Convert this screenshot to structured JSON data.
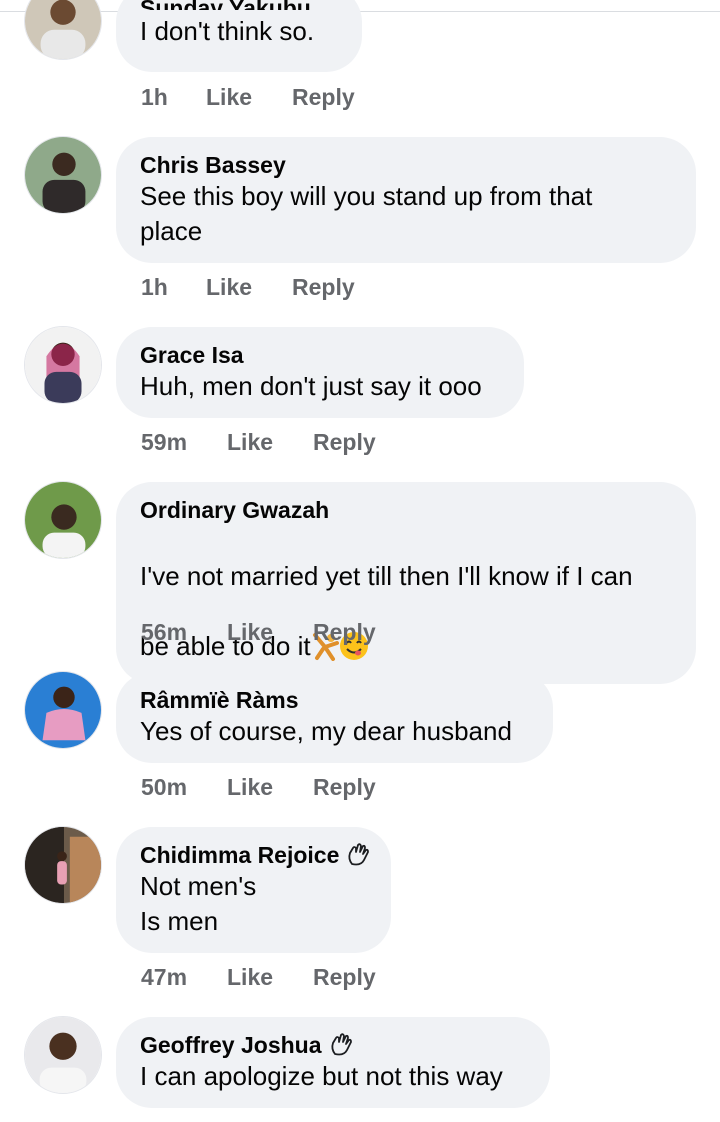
{
  "comments": [
    {
      "name": "Sunday Yakubu",
      "text": "I don't think so.",
      "time": "1h",
      "like": "Like",
      "reply": "Reply"
    },
    {
      "name": "Chris Bassey",
      "text": "See this boy will you stand up from that\nplace",
      "time": "1h",
      "like": "Like",
      "reply": "Reply"
    },
    {
      "name": "Grace Isa",
      "text": "Huh, men don't just say it ooo",
      "time": "59m",
      "like": "Like",
      "reply": "Reply"
    },
    {
      "name": "Ordinary Gwazah",
      "text_line1": "I've not married yet till then I'll know if I can",
      "text_line2": "be able to do it",
      "time": "56m",
      "like": "Like",
      "reply": "Reply"
    },
    {
      "name": "Râmmïè Ràms",
      "text": "Yes of course, my dear husband",
      "time": "50m",
      "like": "Like",
      "reply": "Reply"
    },
    {
      "name": "Chidimma Rejoice",
      "text": "Not men's\nIs men",
      "time": "47m",
      "like": "Like",
      "reply": "Reply"
    },
    {
      "name": "Geoffrey Joshua",
      "text": "I can apologize but not this way"
    }
  ],
  "icons": {
    "badge": "waving-hand-badge-icon",
    "emoji1": "cartwheel-emoji-icon",
    "emoji2": "savoring-face-emoji-icon"
  }
}
